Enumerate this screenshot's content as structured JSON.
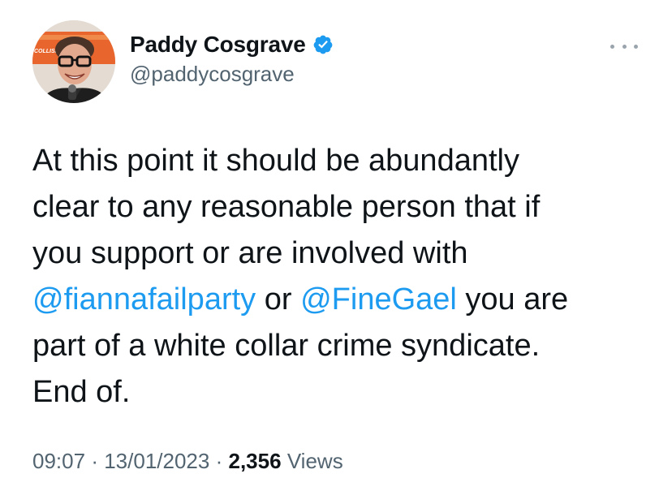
{
  "author": {
    "display_name": "Paddy Cosgrave",
    "handle": "@paddycosgrave",
    "verified_icon": "verified-badge-icon",
    "avatar_banner_text": "COLLISION"
  },
  "tweet": {
    "line1": "At this point it should be abundantly",
    "line2": "clear to any reasonable person that if",
    "line3": "you support or are involved with",
    "mention1": "@fiannafailparty",
    "between": "or",
    "mention2": "@FineGael",
    "line4_end": "you are",
    "line5": "part of a white collar crime syndicate.",
    "line6": "End of."
  },
  "meta": {
    "time": "09:07",
    "separator": "·",
    "date": "13/01/2023",
    "views_count": "2,356",
    "views_label": "Views"
  },
  "colors": {
    "link": "#1d9bf0",
    "text": "#0f1419",
    "secondary": "#536471",
    "verified": "#1d9bf0"
  },
  "icons": {
    "more": "more-options-icon"
  }
}
